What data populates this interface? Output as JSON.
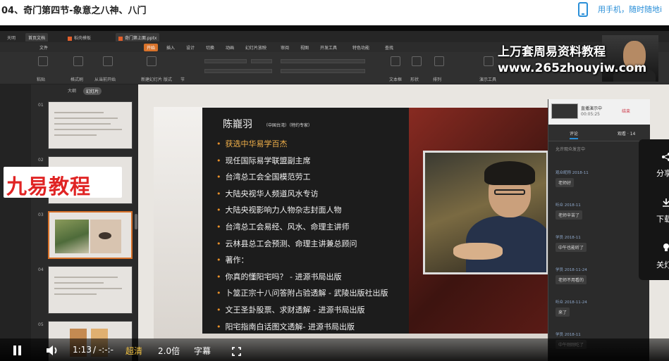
{
  "page": {
    "title": "04、奇门第四节-象意之八神、八门",
    "mobile_text": "用手机，随时随地i"
  },
  "wps": {
    "tabs": [
      "天明",
      "首页文档",
      "稻壳模板",
      "奇门第上面.pptx"
    ],
    "menu": [
      "文件",
      "开始",
      "插入",
      "设计",
      "切换",
      "动画",
      "幻灯片放映",
      "审阅",
      "视图",
      "开发工具",
      "特色功能",
      "查找"
    ],
    "ribbon_labels": [
      "粘贴",
      "格式刷",
      "从当前开始",
      "新建幻灯片",
      "版式",
      "节",
      "文本框",
      "形状",
      "排列",
      "演示工具"
    ],
    "sidebar_tabs": [
      "大纲",
      "幻灯片"
    ],
    "thumb_numbers": [
      "01",
      "02",
      "03",
      "04",
      "05"
    ]
  },
  "slide": {
    "name": "陈巃羽",
    "subtitle": "（中国台湾）（特约专家）",
    "lines": [
      {
        "text": "获选中华易学百杰",
        "highlight": true
      },
      {
        "text": "现任国际易学联盟副主席",
        "highlight": false
      },
      {
        "text": "台湾总工会全国模范劳工",
        "highlight": false
      },
      {
        "text": "大陆央视华人频道风水专访",
        "highlight": false
      },
      {
        "text": "大陆央视影响力人物杂志封面人物",
        "highlight": false
      },
      {
        "text": "台湾总工会易经、风水、命理主讲师",
        "highlight": false
      },
      {
        "text": "云林县总工会预测、命理主讲兼总顾问",
        "highlight": false
      },
      {
        "text": "著作：",
        "highlight": false
      },
      {
        "text": "你真的懂阳宅吗？ - 进源书局出版",
        "highlight": false
      },
      {
        "text": "卜筮正宗十八问答附占验透解 - 武陵出版社出版",
        "highlight": false
      },
      {
        "text": "文王圣卦股票、求财透解 - 进源书局出版",
        "highlight": false
      },
      {
        "text": "阳宅指南白话图文透解- 进源书局出版",
        "highlight": false
      }
    ]
  },
  "watermark": {
    "line1": "上万套周易资料教程",
    "line2": "www.265zhouyiw.com",
    "logo": "九易教程"
  },
  "live": {
    "title": "直播演示中",
    "time": "00:05:25",
    "end": "结束",
    "tabs": [
      "评论",
      "观看 · 14"
    ],
    "notice": "允许观众发言中",
    "comments": [
      {
        "user": "观众昵称 2018-11",
        "text": "老师好"
      },
      {
        "user": "听众 2018-11",
        "text": "老师辛苦了"
      },
      {
        "user": "学员 2018-11",
        "text": "中午也能听了"
      },
      {
        "user": "学员 2018-11-24",
        "text": "老师不用看的"
      },
      {
        "user": "听众 2018-11-24",
        "text": "来了"
      },
      {
        "user": "学员 2018-11",
        "text": "中午刚刚吃了"
      }
    ]
  },
  "float_menu": [
    "分享",
    "下载",
    "关灯"
  ],
  "controls": {
    "time": "1:13",
    "duration": "/ -:-:-",
    "quality": "超清",
    "speed": "2.0倍",
    "subtitle": "字幕"
  },
  "colors": {
    "accent_orange": "#e8902a",
    "logo_red": "#e02424",
    "link_blue": "#2a8fd8",
    "quality_gold": "#f0c040"
  }
}
